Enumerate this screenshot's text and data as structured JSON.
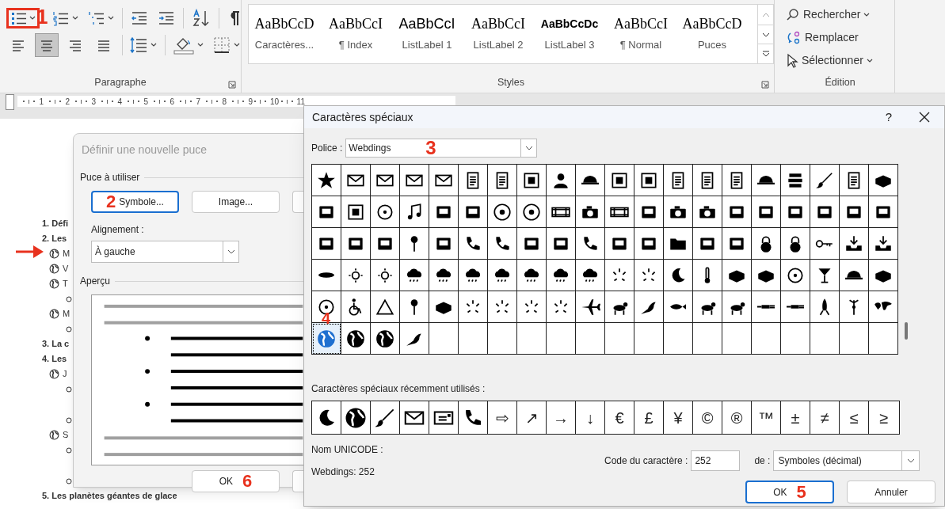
{
  "ribbon": {
    "alignment": [
      {
        "selected": false
      },
      {
        "selected": true
      },
      {
        "selected": false
      },
      {
        "selected": false
      }
    ],
    "paragraph_label": "Paragraphe",
    "styles": [
      {
        "sample": "AaBbCcD",
        "name": "Caractères..."
      },
      {
        "sample": "AaBbCcI",
        "name": "¶ Index"
      },
      {
        "sample": "AaBbCcI",
        "name": "ListLabel 1"
      },
      {
        "sample": "AaBbCcI",
        "name": "ListLabel 2"
      },
      {
        "sample": "AaBbCcDc",
        "name": "ListLabel 3"
      },
      {
        "sample": "AaBbCcI",
        "name": "¶ Normal"
      },
      {
        "sample": "AaBbCcD",
        "name": "Puces"
      }
    ],
    "styles_label": "Styles",
    "edition": [
      {
        "label": "Rechercher",
        "dropdown": true
      },
      {
        "label": "Remplacer",
        "dropdown": false
      },
      {
        "label": "Sélectionner",
        "dropdown": true
      }
    ],
    "edition_label": "Édition"
  },
  "ruler": [
    "1",
    "2",
    "3",
    "4",
    "5",
    "6",
    "7",
    "8",
    "9",
    "10",
    "11"
  ],
  "document": [
    {
      "kind": "heading",
      "text": "1. Défi"
    },
    {
      "kind": "heading",
      "text": "2. Les"
    },
    {
      "kind": "bullet",
      "text": "M"
    },
    {
      "kind": "bullet",
      "text": "V"
    },
    {
      "kind": "bullet",
      "text": "T"
    },
    {
      "kind": "sub"
    },
    {
      "kind": "bullet",
      "text": "M"
    },
    {
      "kind": "sub"
    },
    {
      "kind": "heading",
      "text": "3. La c"
    },
    {
      "kind": "heading",
      "text": "4. Les"
    },
    {
      "kind": "bullet",
      "text": "J"
    },
    {
      "kind": "sub"
    },
    {
      "kind": "sub"
    },
    {
      "kind": "bullet",
      "text": "S"
    },
    {
      "kind": "sub"
    },
    {
      "kind": "sub"
    },
    {
      "kind": "heading",
      "text": "5. Les planètes géantes de glace"
    }
  ],
  "bullet_dialog": {
    "title": "Définir une nouvelle puce",
    "group_label": "Puce à utiliser",
    "buttons": [
      {
        "label": "Symbole...",
        "focused": true
      },
      {
        "label": "Image...",
        "focused": false
      }
    ],
    "alignment_label": "Alignement :",
    "alignment": "À gauche",
    "preview_label": "Aperçu",
    "ok": "OK"
  },
  "symbol_dialog": {
    "title": "Caractères spéciaux",
    "help": "?",
    "font_label": "Police :",
    "font": "Webdings",
    "symbols": [
      {
        "selected": false
      },
      {
        "selected": false
      },
      {
        "selected": false
      },
      {
        "selected": false
      },
      {
        "selected": false
      },
      {
        "selected": false
      },
      {
        "selected": false
      },
      {
        "selected": false
      },
      {
        "selected": false
      },
      {
        "selected": false
      },
      {
        "selected": false
      },
      {
        "selected": false
      },
      {
        "selected": false
      },
      {
        "selected": false
      },
      {
        "selected": false
      },
      {
        "selected": false
      },
      {
        "selected": false
      },
      {
        "selected": false
      },
      {
        "selected": false
      },
      {
        "selected": false
      },
      {
        "selected": false
      },
      {
        "selected": false
      },
      {
        "selected": false
      },
      {
        "selected": false
      },
      {
        "selected": false
      },
      {
        "selected": false
      },
      {
        "selected": false
      },
      {
        "selected": false
      },
      {
        "selected": false
      },
      {
        "selected": false
      },
      {
        "selected": false
      },
      {
        "selected": false
      },
      {
        "selected": false
      },
      {
        "selected": false
      },
      {
        "selected": false
      },
      {
        "selected": false
      },
      {
        "selected": false
      },
      {
        "selected": false
      },
      {
        "selected": false
      },
      {
        "selected": false
      },
      {
        "selected": false
      },
      {
        "selected": false
      },
      {
        "selected": false
      },
      {
        "selected": false
      },
      {
        "selected": false
      },
      {
        "selected": false
      },
      {
        "selected": false
      },
      {
        "selected": false
      },
      {
        "selected": false
      },
      {
        "selected": false
      },
      {
        "selected": false
      },
      {
        "selected": false
      },
      {
        "selected": false
      },
      {
        "selected": false
      },
      {
        "selected": false
      },
      {
        "selected": false
      },
      {
        "selected": false
      },
      {
        "selected": false
      },
      {
        "selected": false
      },
      {
        "selected": false
      },
      {
        "selected": false
      },
      {
        "selected": false
      },
      {
        "selected": false
      },
      {
        "selected": false
      },
      {
        "selected": false
      },
      {
        "selected": false
      },
      {
        "selected": false
      },
      {
        "selected": false
      },
      {
        "selected": false
      },
      {
        "selected": false
      },
      {
        "selected": false
      },
      {
        "selected": false
      },
      {
        "selected": false
      },
      {
        "selected": false
      },
      {
        "selected": false
      },
      {
        "selected": false
      },
      {
        "selected": false
      },
      {
        "selected": false
      },
      {
        "selected": false
      },
      {
        "selected": false
      },
      {
        "selected": false
      },
      {
        "selected": false
      },
      {
        "selected": false
      },
      {
        "selected": false
      },
      {
        "selected": false
      },
      {
        "selected": false
      },
      {
        "selected": false
      },
      {
        "selected": false
      },
      {
        "selected": false
      },
      {
        "selected": false
      },
      {
        "selected": false
      },
      {
        "selected": false
      },
      {
        "selected": false
      },
      {
        "selected": false
      },
      {
        "selected": false
      },
      {
        "selected": false
      },
      {
        "selected": false
      },
      {
        "selected": false
      },
      {
        "selected": false
      },
      {
        "selected": false
      },
      {
        "selected": true
      },
      {
        "selected": false
      },
      {
        "selected": false
      },
      {
        "selected": false
      }
    ],
    "recent_label": "Caractères spéciaux récemment utilisés :",
    "recent": [
      {
        "kind": "icon"
      },
      {
        "kind": "icon"
      },
      {
        "kind": "icon"
      },
      {
        "kind": "icon"
      },
      {
        "kind": "icon"
      },
      {
        "kind": "icon"
      },
      {
        "kind": "char",
        "text": "⇨"
      },
      {
        "kind": "char",
        "text": "↗"
      },
      {
        "kind": "char",
        "text": "→"
      },
      {
        "kind": "char",
        "text": "↓"
      },
      {
        "kind": "char",
        "text": "€"
      },
      {
        "kind": "char",
        "text": "£"
      },
      {
        "kind": "char",
        "text": "¥"
      },
      {
        "kind": "char",
        "text": "©"
      },
      {
        "kind": "char",
        "text": "®"
      },
      {
        "kind": "char",
        "text": "™"
      },
      {
        "kind": "char",
        "text": "±"
      },
      {
        "kind": "char",
        "text": "≠"
      },
      {
        "kind": "char",
        "text": "≤"
      },
      {
        "kind": "char",
        "text": "≥"
      }
    ],
    "unicode_label": "Nom UNICODE :",
    "char_info": "Webdings: 252",
    "code_label": "Code du caractère :",
    "code": "252",
    "from_label": "de :",
    "from": "Symboles (décimal)",
    "buttons": [
      {
        "label": "OK",
        "focused": true
      },
      {
        "label": "Annuler",
        "focused": false
      }
    ]
  },
  "callouts": [
    "1",
    "2",
    "3",
    "4",
    "5",
    "6"
  ]
}
